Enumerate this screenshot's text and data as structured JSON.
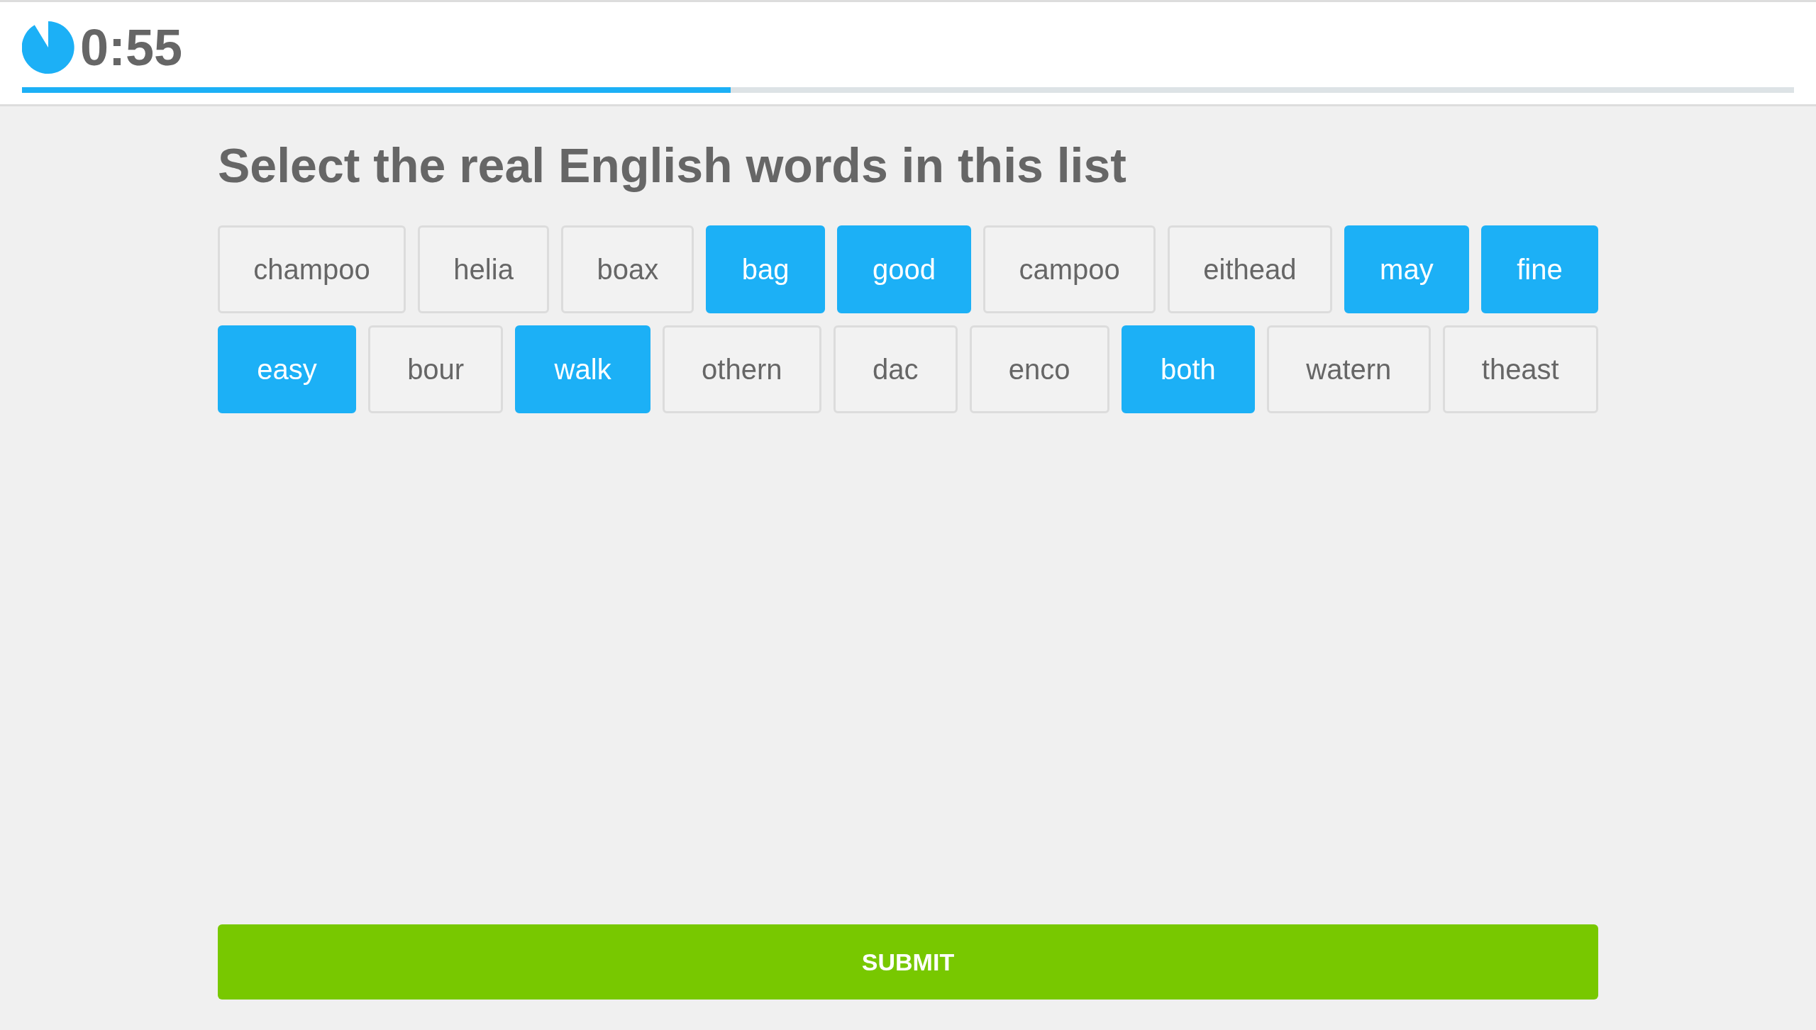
{
  "timer": {
    "time": "0:55"
  },
  "progress": {
    "level": 0.4
  },
  "prompt": "Select the real English words in this list",
  "word_rows": [
    [
      {
        "word": "champoo",
        "selected": false
      },
      {
        "word": "helia",
        "selected": false
      },
      {
        "word": "boax",
        "selected": false
      },
      {
        "word": "bag",
        "selected": true
      },
      {
        "word": "good",
        "selected": true
      },
      {
        "word": "campoo",
        "selected": false
      },
      {
        "word": "eithead",
        "selected": false
      },
      {
        "word": "may",
        "selected": true
      },
      {
        "word": "fine",
        "selected": true
      }
    ],
    [
      {
        "word": "easy",
        "selected": true
      },
      {
        "word": "bour",
        "selected": false
      },
      {
        "word": "walk",
        "selected": true
      },
      {
        "word": "othern",
        "selected": false
      },
      {
        "word": "dac",
        "selected": false
      },
      {
        "word": "enco",
        "selected": false
      },
      {
        "word": "both",
        "selected": true
      },
      {
        "word": "watern",
        "selected": false
      },
      {
        "word": "theast",
        "selected": false
      }
    ]
  ],
  "submit": "SUBMIT"
}
